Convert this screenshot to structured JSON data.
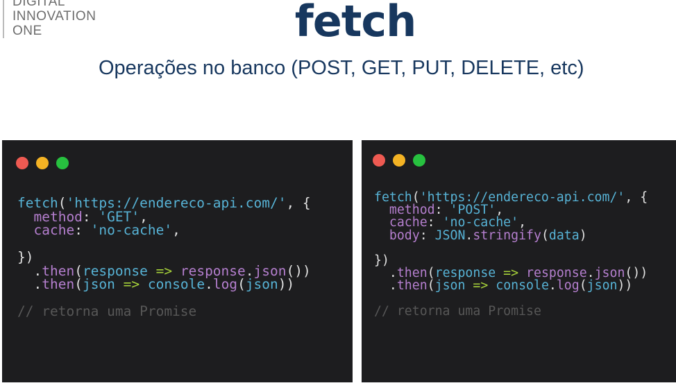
{
  "logo": {
    "lines": [
      "DIGITAL",
      "INNOVATION",
      "ONE"
    ]
  },
  "title": "fetch",
  "subtitle": "Operações no banco (POST, GET, PUT, DELETE, etc)",
  "colors": {
    "red": "#ee5a52",
    "yellow": "#f4b324",
    "green": "#27c13f",
    "panel_bg": "#1d1d1f",
    "title": "#17375e"
  },
  "panels": [
    {
      "name": "get-example",
      "lines": [
        [
          {
            "t": "fetch",
            "c": "b"
          },
          {
            "t": "(",
            "c": "w"
          },
          {
            "t": "'https://endereco-api.com/'",
            "c": "b"
          },
          {
            "t": ", {",
            "c": "w"
          }
        ],
        [
          {
            "t": "  method",
            "c": "p"
          },
          {
            "t": ": ",
            "c": "w"
          },
          {
            "t": "'GET'",
            "c": "b"
          },
          {
            "t": ",",
            "c": "w"
          }
        ],
        [
          {
            "t": "  cache",
            "c": "p"
          },
          {
            "t": ": ",
            "c": "w"
          },
          {
            "t": "'no-cache'",
            "c": "b"
          },
          {
            "t": ",",
            "c": "w"
          }
        ],
        [],
        [
          {
            "t": "})",
            "c": "w"
          }
        ],
        [
          {
            "t": "  .",
            "c": "w"
          },
          {
            "t": "then",
            "c": "p"
          },
          {
            "t": "(",
            "c": "w"
          },
          {
            "t": "response",
            "c": "b"
          },
          {
            "t": " => ",
            "c": "g"
          },
          {
            "t": "response",
            "c": "p"
          },
          {
            "t": ".",
            "c": "w"
          },
          {
            "t": "json",
            "c": "p"
          },
          {
            "t": "())",
            "c": "w"
          }
        ],
        [
          {
            "t": "  .",
            "c": "w"
          },
          {
            "t": "then",
            "c": "p"
          },
          {
            "t": "(",
            "c": "w"
          },
          {
            "t": "json",
            "c": "b"
          },
          {
            "t": " => ",
            "c": "g"
          },
          {
            "t": "console",
            "c": "b"
          },
          {
            "t": ".",
            "c": "w"
          },
          {
            "t": "log",
            "c": "p"
          },
          {
            "t": "(",
            "c": "w"
          },
          {
            "t": "json",
            "c": "b"
          },
          {
            "t": "))",
            "c": "w"
          }
        ],
        [],
        [
          {
            "t": "// retorna uma Promise",
            "c": "c"
          }
        ]
      ]
    },
    {
      "name": "post-example",
      "lines": [
        [
          {
            "t": "fetch",
            "c": "b"
          },
          {
            "t": "(",
            "c": "w"
          },
          {
            "t": "'https://endereco-api.com/'",
            "c": "b"
          },
          {
            "t": ", {",
            "c": "w"
          }
        ],
        [
          {
            "t": "  method",
            "c": "p"
          },
          {
            "t": ": ",
            "c": "w"
          },
          {
            "t": "'POST'",
            "c": "b"
          },
          {
            "t": ",",
            "c": "w"
          }
        ],
        [
          {
            "t": "  cache",
            "c": "p"
          },
          {
            "t": ": ",
            "c": "w"
          },
          {
            "t": "'no-cache'",
            "c": "b"
          },
          {
            "t": ",",
            "c": "w"
          }
        ],
        [
          {
            "t": "  body",
            "c": "p"
          },
          {
            "t": ": ",
            "c": "w"
          },
          {
            "t": "JSON",
            "c": "b"
          },
          {
            "t": ".",
            "c": "w"
          },
          {
            "t": "stringify",
            "c": "p"
          },
          {
            "t": "(",
            "c": "w"
          },
          {
            "t": "data",
            "c": "b"
          },
          {
            "t": ")",
            "c": "w"
          }
        ],
        [],
        [
          {
            "t": "})",
            "c": "w"
          }
        ],
        [
          {
            "t": "  .",
            "c": "w"
          },
          {
            "t": "then",
            "c": "p"
          },
          {
            "t": "(",
            "c": "w"
          },
          {
            "t": "response",
            "c": "b"
          },
          {
            "t": " => ",
            "c": "g"
          },
          {
            "t": "response",
            "c": "p"
          },
          {
            "t": ".",
            "c": "w"
          },
          {
            "t": "json",
            "c": "p"
          },
          {
            "t": "())",
            "c": "w"
          }
        ],
        [
          {
            "t": "  .",
            "c": "w"
          },
          {
            "t": "then",
            "c": "p"
          },
          {
            "t": "(",
            "c": "w"
          },
          {
            "t": "json",
            "c": "b"
          },
          {
            "t": " => ",
            "c": "g"
          },
          {
            "t": "console",
            "c": "b"
          },
          {
            "t": ".",
            "c": "w"
          },
          {
            "t": "log",
            "c": "p"
          },
          {
            "t": "(",
            "c": "w"
          },
          {
            "t": "json",
            "c": "b"
          },
          {
            "t": "))",
            "c": "w"
          }
        ],
        [],
        [
          {
            "t": "// retorna uma Promise",
            "c": "c"
          }
        ]
      ]
    }
  ]
}
